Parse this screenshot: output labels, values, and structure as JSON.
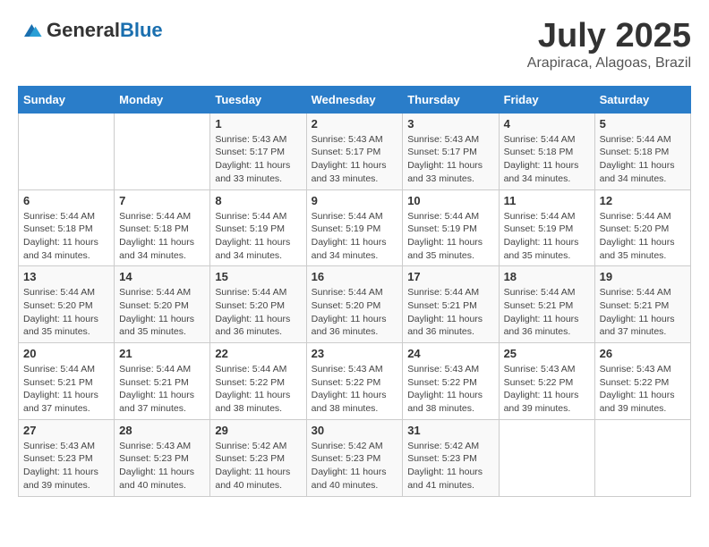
{
  "header": {
    "logo_general": "General",
    "logo_blue": "Blue",
    "month": "July 2025",
    "location": "Arapiraca, Alagoas, Brazil"
  },
  "weekdays": [
    "Sunday",
    "Monday",
    "Tuesday",
    "Wednesday",
    "Thursday",
    "Friday",
    "Saturday"
  ],
  "weeks": [
    [
      null,
      null,
      {
        "day": 1,
        "sunrise": "5:43 AM",
        "sunset": "5:17 PM",
        "daylight": "11 hours and 33 minutes."
      },
      {
        "day": 2,
        "sunrise": "5:43 AM",
        "sunset": "5:17 PM",
        "daylight": "11 hours and 33 minutes."
      },
      {
        "day": 3,
        "sunrise": "5:43 AM",
        "sunset": "5:17 PM",
        "daylight": "11 hours and 33 minutes."
      },
      {
        "day": 4,
        "sunrise": "5:44 AM",
        "sunset": "5:18 PM",
        "daylight": "11 hours and 34 minutes."
      },
      {
        "day": 5,
        "sunrise": "5:44 AM",
        "sunset": "5:18 PM",
        "daylight": "11 hours and 34 minutes."
      }
    ],
    [
      {
        "day": 6,
        "sunrise": "5:44 AM",
        "sunset": "5:18 PM",
        "daylight": "11 hours and 34 minutes."
      },
      {
        "day": 7,
        "sunrise": "5:44 AM",
        "sunset": "5:18 PM",
        "daylight": "11 hours and 34 minutes."
      },
      {
        "day": 8,
        "sunrise": "5:44 AM",
        "sunset": "5:19 PM",
        "daylight": "11 hours and 34 minutes."
      },
      {
        "day": 9,
        "sunrise": "5:44 AM",
        "sunset": "5:19 PM",
        "daylight": "11 hours and 34 minutes."
      },
      {
        "day": 10,
        "sunrise": "5:44 AM",
        "sunset": "5:19 PM",
        "daylight": "11 hours and 35 minutes."
      },
      {
        "day": 11,
        "sunrise": "5:44 AM",
        "sunset": "5:19 PM",
        "daylight": "11 hours and 35 minutes."
      },
      {
        "day": 12,
        "sunrise": "5:44 AM",
        "sunset": "5:20 PM",
        "daylight": "11 hours and 35 minutes."
      }
    ],
    [
      {
        "day": 13,
        "sunrise": "5:44 AM",
        "sunset": "5:20 PM",
        "daylight": "11 hours and 35 minutes."
      },
      {
        "day": 14,
        "sunrise": "5:44 AM",
        "sunset": "5:20 PM",
        "daylight": "11 hours and 35 minutes."
      },
      {
        "day": 15,
        "sunrise": "5:44 AM",
        "sunset": "5:20 PM",
        "daylight": "11 hours and 36 minutes."
      },
      {
        "day": 16,
        "sunrise": "5:44 AM",
        "sunset": "5:20 PM",
        "daylight": "11 hours and 36 minutes."
      },
      {
        "day": 17,
        "sunrise": "5:44 AM",
        "sunset": "5:21 PM",
        "daylight": "11 hours and 36 minutes."
      },
      {
        "day": 18,
        "sunrise": "5:44 AM",
        "sunset": "5:21 PM",
        "daylight": "11 hours and 36 minutes."
      },
      {
        "day": 19,
        "sunrise": "5:44 AM",
        "sunset": "5:21 PM",
        "daylight": "11 hours and 37 minutes."
      }
    ],
    [
      {
        "day": 20,
        "sunrise": "5:44 AM",
        "sunset": "5:21 PM",
        "daylight": "11 hours and 37 minutes."
      },
      {
        "day": 21,
        "sunrise": "5:44 AM",
        "sunset": "5:21 PM",
        "daylight": "11 hours and 37 minutes."
      },
      {
        "day": 22,
        "sunrise": "5:44 AM",
        "sunset": "5:22 PM",
        "daylight": "11 hours and 38 minutes."
      },
      {
        "day": 23,
        "sunrise": "5:43 AM",
        "sunset": "5:22 PM",
        "daylight": "11 hours and 38 minutes."
      },
      {
        "day": 24,
        "sunrise": "5:43 AM",
        "sunset": "5:22 PM",
        "daylight": "11 hours and 38 minutes."
      },
      {
        "day": 25,
        "sunrise": "5:43 AM",
        "sunset": "5:22 PM",
        "daylight": "11 hours and 39 minutes."
      },
      {
        "day": 26,
        "sunrise": "5:43 AM",
        "sunset": "5:22 PM",
        "daylight": "11 hours and 39 minutes."
      }
    ],
    [
      {
        "day": 27,
        "sunrise": "5:43 AM",
        "sunset": "5:23 PM",
        "daylight": "11 hours and 39 minutes."
      },
      {
        "day": 28,
        "sunrise": "5:43 AM",
        "sunset": "5:23 PM",
        "daylight": "11 hours and 40 minutes."
      },
      {
        "day": 29,
        "sunrise": "5:42 AM",
        "sunset": "5:23 PM",
        "daylight": "11 hours and 40 minutes."
      },
      {
        "day": 30,
        "sunrise": "5:42 AM",
        "sunset": "5:23 PM",
        "daylight": "11 hours and 40 minutes."
      },
      {
        "day": 31,
        "sunrise": "5:42 AM",
        "sunset": "5:23 PM",
        "daylight": "11 hours and 41 minutes."
      },
      null,
      null
    ]
  ]
}
